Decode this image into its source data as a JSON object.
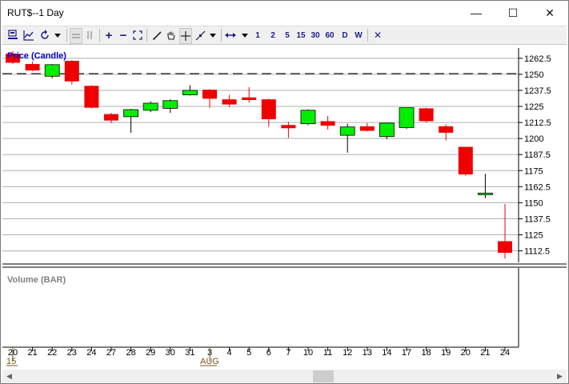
{
  "window": {
    "title": "RUT$--1 Day",
    "minimize_glyph": "—",
    "maximize_glyph": "☐",
    "close_glyph": "✕"
  },
  "toolbar": {
    "zoom_in_glyph": "+",
    "zoom_out_glyph": "−",
    "interval_buttons": [
      "1",
      "2",
      "5",
      "15",
      "30",
      "60",
      "D",
      "W"
    ],
    "close_glyph": "✕"
  },
  "price_panel": {
    "label": "Price (Candle)"
  },
  "volume_panel": {
    "label": "Volume (BAR)"
  },
  "colors": {
    "up": "#00ee00",
    "down": "#ee0000",
    "grid": "#b0b0b0",
    "panel_label_price": "#0000cc",
    "panel_label_volume": "#808080",
    "axis_text": "#000000",
    "month_text": "#7a5a1e"
  },
  "chart_data": {
    "type": "candlestick",
    "title": "Price (Candle)",
    "ylim": [
      1106,
      1268
    ],
    "y_ticks": [
      1112.5,
      1125,
      1137.5,
      1150,
      1162.5,
      1175,
      1187.5,
      1200,
      1212.5,
      1225,
      1237.5,
      1250,
      1262.5
    ],
    "reference_line": 1250.5,
    "x_labels": [
      "20",
      "21",
      "22",
      "23",
      "24",
      "27",
      "28",
      "29",
      "30",
      "31",
      "3",
      "4",
      "5",
      "6",
      "7",
      "10",
      "11",
      "12",
      "13",
      "14",
      "17",
      "18",
      "19",
      "20",
      "21",
      "24"
    ],
    "month_labels": [
      {
        "at_index": 0,
        "text": "15"
      },
      {
        "at_index": 10,
        "text": "AUG"
      }
    ],
    "candles": [
      {
        "o": 1266.0,
        "h": 1268.0,
        "l": 1258.0,
        "c": 1259.0
      },
      {
        "o": 1258.0,
        "h": 1260.0,
        "l": 1252.5,
        "c": 1253.0
      },
      {
        "o": 1248.5,
        "h": 1258.0,
        "l": 1247.0,
        "c": 1257.5
      },
      {
        "o": 1260.5,
        "h": 1261.0,
        "l": 1242.0,
        "c": 1244.5
      },
      {
        "o": 1241.0,
        "h": 1241.5,
        "l": 1223.5,
        "c": 1224.0
      },
      {
        "o": 1219.0,
        "h": 1220.0,
        "l": 1212.0,
        "c": 1214.0
      },
      {
        "o": 1217.0,
        "h": 1223.0,
        "l": 1204.5,
        "c": 1222.5
      },
      {
        "o": 1222.0,
        "h": 1229.0,
        "l": 1220.5,
        "c": 1227.5
      },
      {
        "o": 1223.5,
        "h": 1230.5,
        "l": 1220.0,
        "c": 1229.5
      },
      {
        "o": 1234.0,
        "h": 1241.5,
        "l": 1233.5,
        "c": 1237.5
      },
      {
        "o": 1238.0,
        "h": 1238.5,
        "l": 1224.0,
        "c": 1231.0
      },
      {
        "o": 1230.5,
        "h": 1234.0,
        "l": 1224.5,
        "c": 1226.5
      },
      {
        "o": 1232.0,
        "h": 1240.0,
        "l": 1228.0,
        "c": 1230.0
      },
      {
        "o": 1230.5,
        "h": 1231.0,
        "l": 1209.0,
        "c": 1215.0
      },
      {
        "o": 1210.5,
        "h": 1213.0,
        "l": 1200.5,
        "c": 1208.0
      },
      {
        "o": 1211.5,
        "h": 1222.5,
        "l": 1210.5,
        "c": 1222.0
      },
      {
        "o": 1213.5,
        "h": 1217.5,
        "l": 1207.0,
        "c": 1210.0
      },
      {
        "o": 1202.5,
        "h": 1211.5,
        "l": 1189.0,
        "c": 1209.0
      },
      {
        "o": 1209.5,
        "h": 1212.0,
        "l": 1205.5,
        "c": 1206.0
      },
      {
        "o": 1201.5,
        "h": 1212.0,
        "l": 1199.5,
        "c": 1212.0
      },
      {
        "o": 1208.5,
        "h": 1224.0,
        "l": 1207.5,
        "c": 1224.0
      },
      {
        "o": 1223.5,
        "h": 1224.0,
        "l": 1212.5,
        "c": 1213.5
      },
      {
        "o": 1209.5,
        "h": 1211.0,
        "l": 1198.5,
        "c": 1204.5
      },
      {
        "o": 1193.5,
        "h": 1193.5,
        "l": 1171.0,
        "c": 1172.0
      },
      {
        "o": 1157.5,
        "h": 1172.5,
        "l": 1153.5,
        "c": 1157.5
      },
      {
        "o": 1120.0,
        "h": 1149.0,
        "l": 1106.5,
        "c": 1111.0
      }
    ]
  }
}
